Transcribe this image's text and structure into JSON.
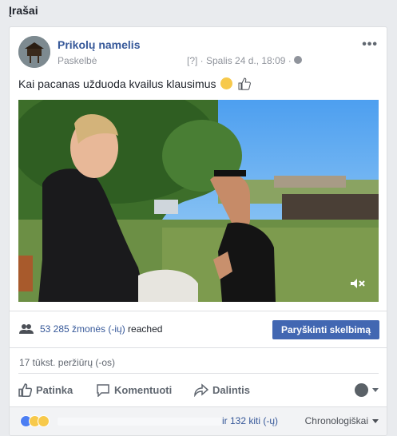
{
  "section": {
    "title": "Įrašai"
  },
  "post": {
    "page_name": "Prikolų namelis",
    "posted_by": "Paskelbė",
    "date": "[?] · Spalis 24 d., 18:09 ·",
    "text": "Kai pacanas užduoda kvailus klausimus",
    "video_icons": [
      "mute-icon"
    ]
  },
  "insights": {
    "reach_count": "53 285 žmonės (-ių)",
    "reach_suffix": " reached",
    "boost_label": "Paryškinti skelbimą",
    "views": "17 tūkst. peržiūrų (-os)"
  },
  "actions": {
    "like": "Patinka",
    "comment": "Komentuoti",
    "share": "Dalintis"
  },
  "reactions": {
    "others": "ir 132 kiti (-ų)",
    "sort": "Chronologiškai",
    "icons": [
      "like-reaction-icon",
      "haha-reaction-icon",
      "sad-reaction-icon"
    ]
  },
  "colors": {
    "link": "#365899",
    "button": "#4267b2",
    "background": "#e9ebee"
  }
}
